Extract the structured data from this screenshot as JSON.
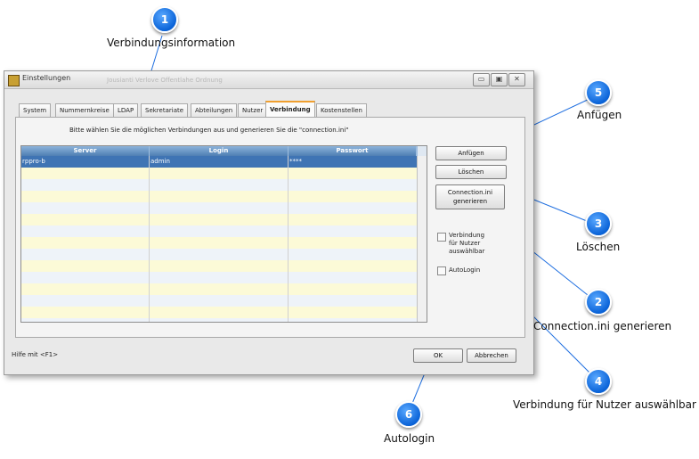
{
  "window": {
    "title": "Einstellungen",
    "title_ghost": "Jousianti Verlove Offentlahe Ordnung",
    "minimize_glyph": "▭",
    "maximize_glyph": "▣",
    "close_glyph": "✕"
  },
  "tabs": [
    {
      "label": "System",
      "active": false
    },
    {
      "label": "Nummernkreise",
      "active": false
    },
    {
      "label": "LDAP",
      "active": false
    },
    {
      "label": "Sekretariate",
      "active": false
    },
    {
      "label": "Abteilungen",
      "active": false
    },
    {
      "label": "Nutzer",
      "active": false
    },
    {
      "label": "Verbindung",
      "active": true
    },
    {
      "label": "Kostenstellen",
      "active": false
    }
  ],
  "hint": "Bitte wählen Sie die möglichen Verbindungen aus und generieren Sie die \"connection.ini\"",
  "grid": {
    "columns": [
      "Server",
      "Login",
      "Passwort"
    ],
    "rows": [
      {
        "server": "rppro-b",
        "login": "admin",
        "password": "****",
        "selected": true
      }
    ],
    "empty_rows": 14
  },
  "buttons": {
    "append": "Anfügen",
    "delete": "Löschen",
    "generate_line1": "Connection.ini",
    "generate_line2": "generieren"
  },
  "checkboxes": {
    "user_selectable": {
      "label_lines": [
        "Verbindung",
        "für Nutzer",
        "auswählbar"
      ],
      "checked": false
    },
    "autologin": {
      "label": "AutoLogin",
      "checked": false
    }
  },
  "status": {
    "help": "Hilfe mit <F1>",
    "ok": "OK",
    "cancel": "Abbrechen"
  },
  "callouts": [
    {
      "num": "1",
      "label": "Verbindungsinformation"
    },
    {
      "num": "2",
      "label": "Connection.ini generieren"
    },
    {
      "num": "3",
      "label": "Löschen"
    },
    {
      "num": "4",
      "label": "Verbindung für Nutzer auswählbar"
    },
    {
      "num": "5",
      "label": "Anfügen"
    },
    {
      "num": "6",
      "label": "Autologin"
    }
  ],
  "colors": {
    "callout_blue": "#0a63d8",
    "grid_header": "#5d8cbf",
    "selected_row": "#3f74b4",
    "odd_row": "#fcfad7",
    "even_row": "#eef3f9",
    "active_tab_accent": "#f0a030"
  }
}
